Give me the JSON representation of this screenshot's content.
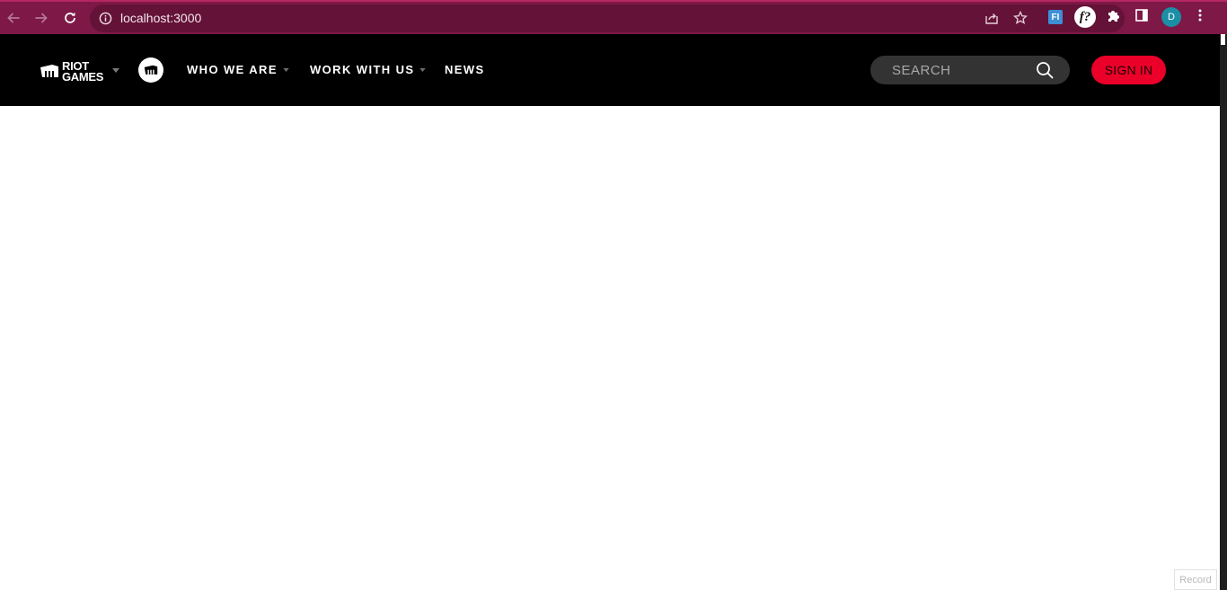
{
  "browser": {
    "url": "localhost:3000",
    "avatar_letter": "D",
    "ext_fi_label": "FI",
    "ext_f_label": "f?",
    "icons": [
      "back-icon",
      "forward-icon",
      "reload-icon",
      "info-icon",
      "share-icon",
      "star-icon",
      "puzzle-icon",
      "sidepanel-icon",
      "menu-dots-icon"
    ],
    "colors": {
      "chrome": "#7e1846",
      "omnibox": "#641238"
    }
  },
  "header": {
    "logo_line1": "RIOT",
    "logo_line2": "GAMES",
    "nav": [
      {
        "label": "WHO WE ARE",
        "has_dropdown": true
      },
      {
        "label": "WORK WITH US",
        "has_dropdown": true
      },
      {
        "label": "NEWS",
        "has_dropdown": false
      }
    ],
    "search": {
      "placeholder": "SEARCH"
    },
    "signin_label": "SIGN IN",
    "colors": {
      "background": "#000000",
      "accent": "#eb0029"
    }
  },
  "footer": {
    "record_label": "Record"
  }
}
